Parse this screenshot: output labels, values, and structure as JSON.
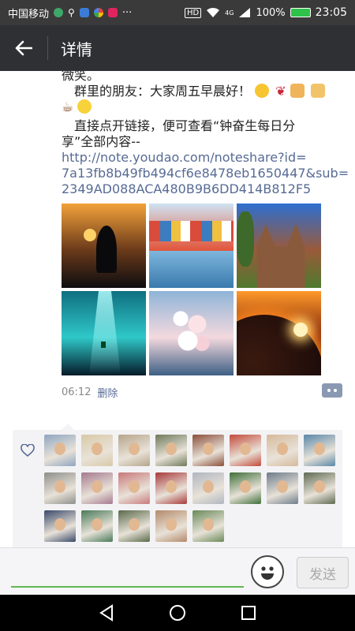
{
  "status_bar": {
    "carrier": "中国移动",
    "battery_percent": "100%",
    "time": "23:05",
    "hd_label": "HD",
    "network_label": "4G",
    "dots": "···"
  },
  "header": {
    "title": "详情",
    "back_icon": "arrow-left-icon"
  },
  "post": {
    "line_top": "微笑。",
    "greeting": "群里的朋友：大家周五早晨好！",
    "instruction_line1": "直接点开链接，便可查看“钟奋生每日分",
    "instruction_line2": "享”全部内容--",
    "link_line1": "http://note.youdao.com/noteshare?id=",
    "link_line2": "7a13fb8b49fb494cf6e8478eb1650447&sub=",
    "link_line3": "2349AD088ACA480B9B6DD414B812F5",
    "photos": [
      {
        "name": "photo-heron-sunset",
        "colors": [
          "#f2a23a",
          "#6b3a1a",
          "#0d0d10"
        ]
      },
      {
        "name": "photo-colorful-houses",
        "colors": [
          "#cfe3f2",
          "#e2563b",
          "#3c7cc0"
        ]
      },
      {
        "name": "photo-church-towers",
        "colors": [
          "#2d6fd0",
          "#9a5a3a",
          "#4f7a2e"
        ]
      },
      {
        "name": "photo-underwater-cave",
        "colors": [
          "#0f6f80",
          "#2fc8c8",
          "#041a28"
        ]
      },
      {
        "name": "photo-cherry-blossoms",
        "colors": [
          "#8fb4d8",
          "#f4d9de",
          "#3d5f84"
        ]
      },
      {
        "name": "photo-planet-eclipse",
        "colors": [
          "#ff9a2a",
          "#7a1f0a",
          "#05070e"
        ]
      }
    ],
    "time": "06:12",
    "delete_label": "删除",
    "comment_icon": "comment-dots-icon"
  },
  "likes": {
    "icon": "heart-outline-icon",
    "avatar_colors": [
      "#8fa6c0",
      "#d8c9a7",
      "#b6a58a",
      "#6f7a5a",
      "#8b4f3a",
      "#c44a3a",
      "#d6b99a",
      "#5a87a8",
      "#8e8f8a",
      "#a6798e",
      "#c8787a",
      "#a83a3a",
      "#b0b6c0",
      "#3f6f3a",
      "#6d7c8a",
      "#5f6a52",
      "#3a4a6a",
      "#4a7a5a",
      "#5a6a4a",
      "#b48a6a",
      "#6a8a5a"
    ]
  },
  "input": {
    "placeholder": "",
    "emoji_icon": "smiley-face-icon",
    "send_label": "发送"
  },
  "nav": {
    "back_icon": "triangle-back-icon",
    "home_icon": "circle-home-icon",
    "recents_icon": "square-recents-icon"
  }
}
